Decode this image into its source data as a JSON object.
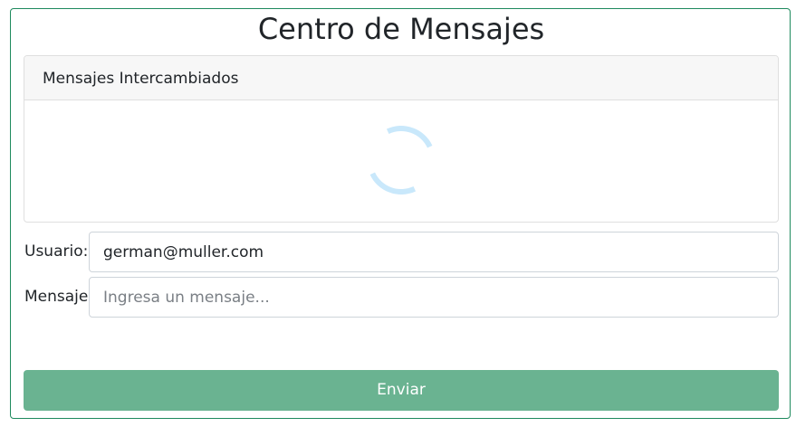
{
  "page": {
    "title": "Centro de Mensajes"
  },
  "messages_panel": {
    "header": "Mensajes Intercambiados",
    "loading": true
  },
  "form": {
    "user_label": "Usuario:",
    "user_value": "german@muller.com",
    "message_label": "Mensaje",
    "message_value": "",
    "message_placeholder": "Ingresa un mensaje...",
    "send_label": "Enviar"
  },
  "colors": {
    "frame_border": "#1f8a5e",
    "button_background": "#6ab391",
    "spinner": "#c9e8fb",
    "card_header_background": "#f7f7f7"
  },
  "icons": {
    "spinner": "loading-spinner-icon"
  }
}
